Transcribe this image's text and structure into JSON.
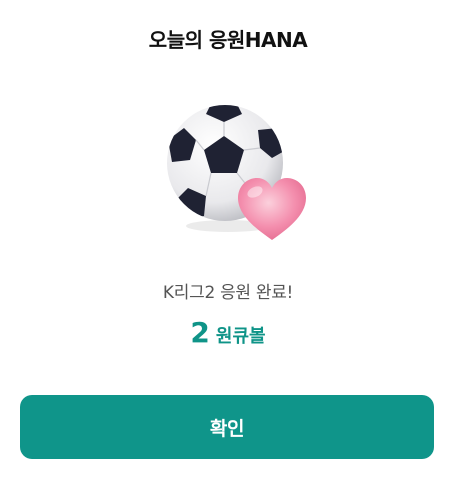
{
  "dialog": {
    "title": "오늘의 응원HANA",
    "message": "K리그2 응원 완료!",
    "reward": {
      "count": "2",
      "unit": "원큐볼"
    },
    "confirm_label": "확인"
  },
  "illustration": {
    "ball_icon": "soccer-ball-icon",
    "heart_icon": "heart-icon"
  },
  "colors": {
    "accent": "#0f958a",
    "reward_text": "#0f9488",
    "title_text": "#111111",
    "message_text": "#555555",
    "heart": "#f07aa0"
  }
}
